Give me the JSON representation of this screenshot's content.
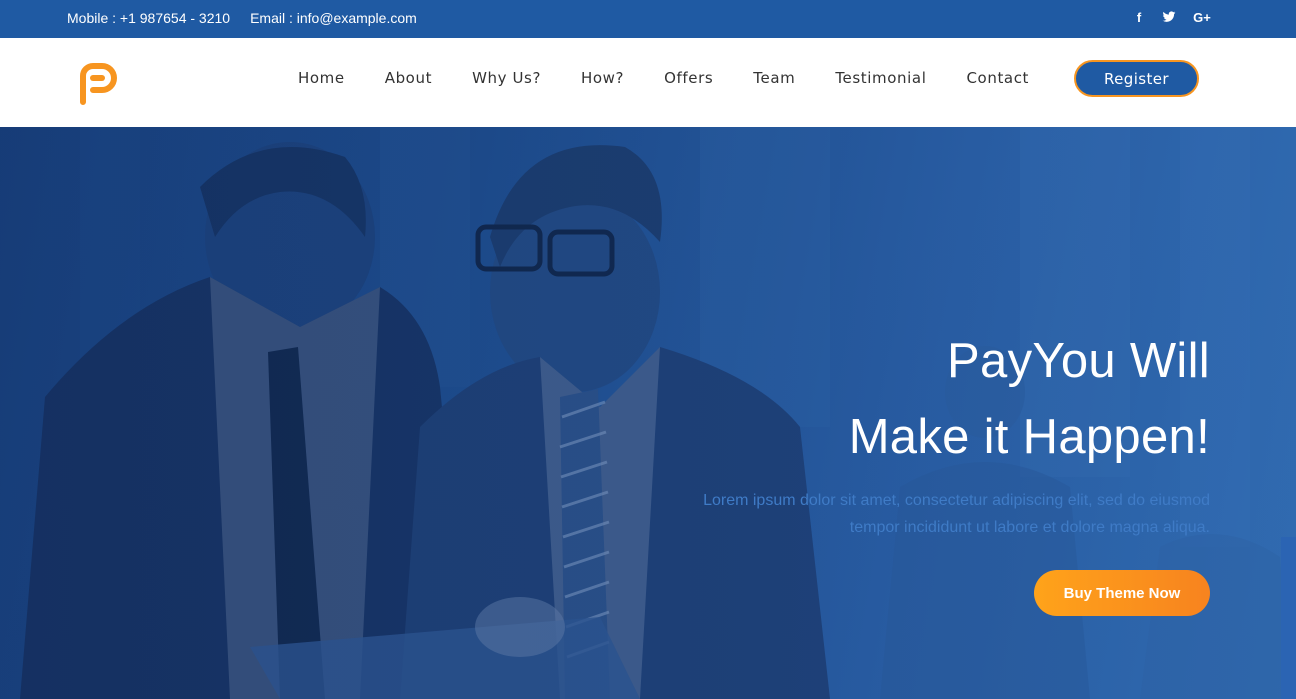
{
  "topbar": {
    "mobile": "Mobile : +1 987654 - 3210",
    "email": "Email : info@example.com",
    "social": [
      {
        "icon": "facebook-icon",
        "glyph": "f"
      },
      {
        "icon": "twitter-icon",
        "glyph": ""
      },
      {
        "icon": "google-plus-icon",
        "glyph": "G+"
      }
    ]
  },
  "header": {
    "logo_icon": "payyou-logo-icon",
    "nav": [
      "Home",
      "About",
      "Why Us?",
      "How?",
      "Offers",
      "Team",
      "Testimonial",
      "Contact"
    ],
    "register_label": "Register"
  },
  "hero": {
    "title_line1": "PayYou Will",
    "title_line2": "Make it Happen!",
    "desc_line1": "Lorem ipsum dolor sit amet, consectetur adipiscing elit, sed do eiusmod",
    "desc_line2": "tempor incididunt ut labore et dolore magna aliqua.",
    "cta_label": "Buy Theme Now"
  },
  "colors": {
    "brand_blue": "#1f5aa3",
    "accent_orange": "#f79520",
    "desc_text": "#3f7bc6"
  }
}
